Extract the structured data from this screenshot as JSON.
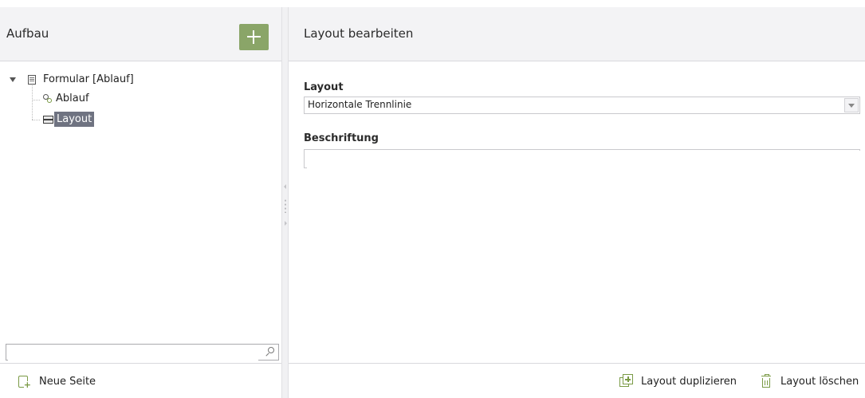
{
  "left_panel": {
    "title": "Aufbau",
    "tree": {
      "root": {
        "label": "Formular [Ablauf]",
        "icon": "document-icon",
        "expanded": true
      },
      "children": [
        {
          "label": "Ablauf",
          "icon": "flow-icon",
          "selected": false
        },
        {
          "label": "Layout",
          "icon": "layout-icon",
          "selected": true
        }
      ]
    },
    "search": {
      "value": "",
      "placeholder": ""
    },
    "footer": {
      "new_page_label": "Neue Seite"
    }
  },
  "right_panel": {
    "title": "Layout bearbeiten",
    "fields": {
      "layout_label": "Layout",
      "layout_value": "Horizontale Trennlinie",
      "caption_label": "Beschriftung",
      "caption_value": ""
    },
    "footer": {
      "duplicate_label": "Layout duplizieren",
      "delete_label": "Layout löschen"
    }
  },
  "colors": {
    "accent_green": "#8aa568",
    "icon_green": "#7a9a45",
    "selection": "#6f7381",
    "header_bg": "#f3f3f5"
  }
}
